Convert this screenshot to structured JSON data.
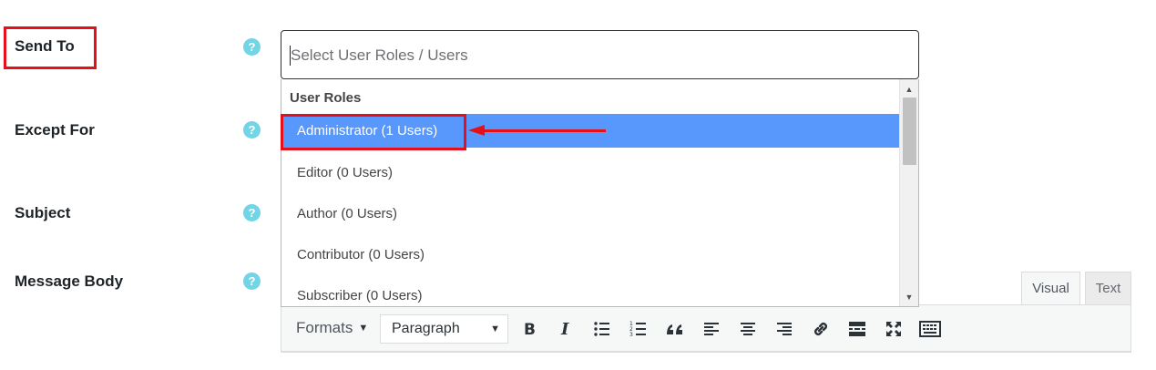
{
  "form": {
    "fields": [
      {
        "label": "Send To"
      },
      {
        "label": "Except For"
      },
      {
        "label": "Subject"
      },
      {
        "label": "Message Body"
      }
    ],
    "help_glyph": "?"
  },
  "send_to": {
    "placeholder": "Select User Roles / Users",
    "dropdown": {
      "group_label": "User Roles",
      "options": [
        {
          "label": "Administrator (1 Users)",
          "highlighted": true
        },
        {
          "label": "Editor (0 Users)",
          "highlighted": false
        },
        {
          "label": "Author (0 Users)",
          "highlighted": false
        },
        {
          "label": "Contributor (0 Users)",
          "highlighted": false
        },
        {
          "label": "Subscriber (0 Users)",
          "highlighted": false
        }
      ]
    }
  },
  "editor": {
    "tabs": [
      {
        "label": "Visual",
        "active": true
      },
      {
        "label": "Text",
        "active": false
      }
    ],
    "toolbar": {
      "formats_label": "Formats",
      "block_format_value": "Paragraph",
      "buttons": [
        "bold-icon",
        "italic-icon",
        "bullet-list-icon",
        "numbered-list-icon",
        "blockquote-icon",
        "align-left-icon",
        "align-center-icon",
        "align-right-icon",
        "link-icon",
        "read-more-icon",
        "fullscreen-icon",
        "toolbar-toggle-icon"
      ]
    }
  },
  "colors": {
    "highlight": "#5897fb",
    "annotation": "#e5101a",
    "help_icon": "#72d5e6"
  }
}
